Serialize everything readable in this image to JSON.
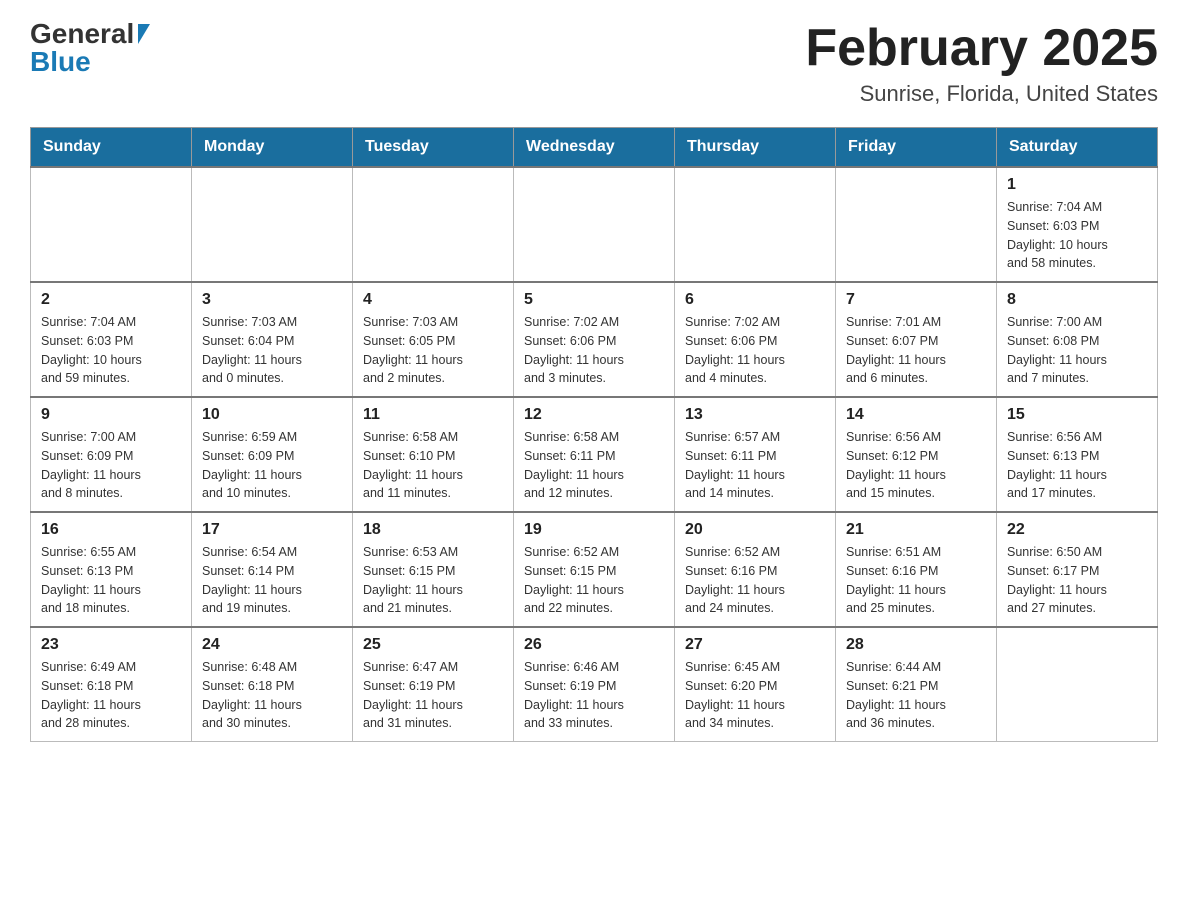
{
  "logo": {
    "general": "General",
    "blue": "Blue"
  },
  "header": {
    "month_year": "February 2025",
    "location": "Sunrise, Florida, United States"
  },
  "days_of_week": [
    "Sunday",
    "Monday",
    "Tuesday",
    "Wednesday",
    "Thursday",
    "Friday",
    "Saturday"
  ],
  "weeks": [
    [
      {
        "day": "",
        "info": ""
      },
      {
        "day": "",
        "info": ""
      },
      {
        "day": "",
        "info": ""
      },
      {
        "day": "",
        "info": ""
      },
      {
        "day": "",
        "info": ""
      },
      {
        "day": "",
        "info": ""
      },
      {
        "day": "1",
        "info": "Sunrise: 7:04 AM\nSunset: 6:03 PM\nDaylight: 10 hours\nand 58 minutes."
      }
    ],
    [
      {
        "day": "2",
        "info": "Sunrise: 7:04 AM\nSunset: 6:03 PM\nDaylight: 10 hours\nand 59 minutes."
      },
      {
        "day": "3",
        "info": "Sunrise: 7:03 AM\nSunset: 6:04 PM\nDaylight: 11 hours\nand 0 minutes."
      },
      {
        "day": "4",
        "info": "Sunrise: 7:03 AM\nSunset: 6:05 PM\nDaylight: 11 hours\nand 2 minutes."
      },
      {
        "day": "5",
        "info": "Sunrise: 7:02 AM\nSunset: 6:06 PM\nDaylight: 11 hours\nand 3 minutes."
      },
      {
        "day": "6",
        "info": "Sunrise: 7:02 AM\nSunset: 6:06 PM\nDaylight: 11 hours\nand 4 minutes."
      },
      {
        "day": "7",
        "info": "Sunrise: 7:01 AM\nSunset: 6:07 PM\nDaylight: 11 hours\nand 6 minutes."
      },
      {
        "day": "8",
        "info": "Sunrise: 7:00 AM\nSunset: 6:08 PM\nDaylight: 11 hours\nand 7 minutes."
      }
    ],
    [
      {
        "day": "9",
        "info": "Sunrise: 7:00 AM\nSunset: 6:09 PM\nDaylight: 11 hours\nand 8 minutes."
      },
      {
        "day": "10",
        "info": "Sunrise: 6:59 AM\nSunset: 6:09 PM\nDaylight: 11 hours\nand 10 minutes."
      },
      {
        "day": "11",
        "info": "Sunrise: 6:58 AM\nSunset: 6:10 PM\nDaylight: 11 hours\nand 11 minutes."
      },
      {
        "day": "12",
        "info": "Sunrise: 6:58 AM\nSunset: 6:11 PM\nDaylight: 11 hours\nand 12 minutes."
      },
      {
        "day": "13",
        "info": "Sunrise: 6:57 AM\nSunset: 6:11 PM\nDaylight: 11 hours\nand 14 minutes."
      },
      {
        "day": "14",
        "info": "Sunrise: 6:56 AM\nSunset: 6:12 PM\nDaylight: 11 hours\nand 15 minutes."
      },
      {
        "day": "15",
        "info": "Sunrise: 6:56 AM\nSunset: 6:13 PM\nDaylight: 11 hours\nand 17 minutes."
      }
    ],
    [
      {
        "day": "16",
        "info": "Sunrise: 6:55 AM\nSunset: 6:13 PM\nDaylight: 11 hours\nand 18 minutes."
      },
      {
        "day": "17",
        "info": "Sunrise: 6:54 AM\nSunset: 6:14 PM\nDaylight: 11 hours\nand 19 minutes."
      },
      {
        "day": "18",
        "info": "Sunrise: 6:53 AM\nSunset: 6:15 PM\nDaylight: 11 hours\nand 21 minutes."
      },
      {
        "day": "19",
        "info": "Sunrise: 6:52 AM\nSunset: 6:15 PM\nDaylight: 11 hours\nand 22 minutes."
      },
      {
        "day": "20",
        "info": "Sunrise: 6:52 AM\nSunset: 6:16 PM\nDaylight: 11 hours\nand 24 minutes."
      },
      {
        "day": "21",
        "info": "Sunrise: 6:51 AM\nSunset: 6:16 PM\nDaylight: 11 hours\nand 25 minutes."
      },
      {
        "day": "22",
        "info": "Sunrise: 6:50 AM\nSunset: 6:17 PM\nDaylight: 11 hours\nand 27 minutes."
      }
    ],
    [
      {
        "day": "23",
        "info": "Sunrise: 6:49 AM\nSunset: 6:18 PM\nDaylight: 11 hours\nand 28 minutes."
      },
      {
        "day": "24",
        "info": "Sunrise: 6:48 AM\nSunset: 6:18 PM\nDaylight: 11 hours\nand 30 minutes."
      },
      {
        "day": "25",
        "info": "Sunrise: 6:47 AM\nSunset: 6:19 PM\nDaylight: 11 hours\nand 31 minutes."
      },
      {
        "day": "26",
        "info": "Sunrise: 6:46 AM\nSunset: 6:19 PM\nDaylight: 11 hours\nand 33 minutes."
      },
      {
        "day": "27",
        "info": "Sunrise: 6:45 AM\nSunset: 6:20 PM\nDaylight: 11 hours\nand 34 minutes."
      },
      {
        "day": "28",
        "info": "Sunrise: 6:44 AM\nSunset: 6:21 PM\nDaylight: 11 hours\nand 36 minutes."
      },
      {
        "day": "",
        "info": ""
      }
    ]
  ]
}
